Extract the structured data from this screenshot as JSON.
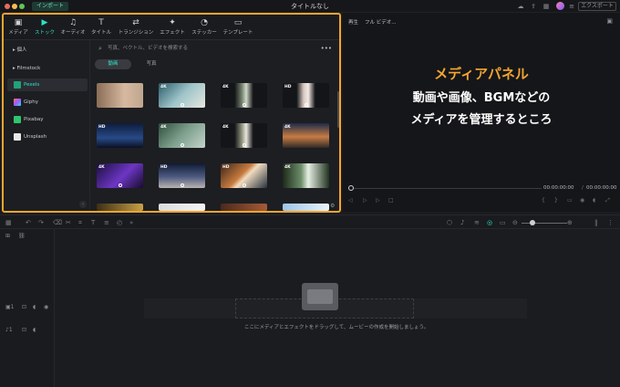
{
  "titlebar": {
    "import_label": "インポート",
    "window_title": "タイトルなし",
    "export_label": "エクスポート"
  },
  "media_panel": {
    "tabs": [
      {
        "label": "メディア",
        "icon": "folder-icon"
      },
      {
        "label": "ストック",
        "icon": "stock-icon",
        "active": true
      },
      {
        "label": "オーディオ",
        "icon": "music-icon"
      },
      {
        "label": "タイトル",
        "icon": "text-icon"
      },
      {
        "label": "トランジション",
        "icon": "transition-icon"
      },
      {
        "label": "エフェクト",
        "icon": "effects-icon"
      },
      {
        "label": "ステッカー",
        "icon": "sticker-icon"
      },
      {
        "label": "テンプレート",
        "icon": "template-icon"
      }
    ],
    "sidebar": {
      "personal": "個人",
      "filmstock": "Filmstock",
      "pexels": "Pexels",
      "giphy": "Giphy",
      "pixabay": "Pixabay",
      "unsplash": "Unsplash"
    },
    "search_placeholder": "写真、ベクトル、ビデオを検索する",
    "segments": {
      "video": "動画",
      "photo": "写真"
    },
    "thumbnails": [
      {
        "badge": ""
      },
      {
        "badge": "4K"
      },
      {
        "badge": "4K"
      },
      {
        "badge": "HD"
      },
      {
        "badge": "HD"
      },
      {
        "badge": "4K"
      },
      {
        "badge": "4K"
      },
      {
        "badge": "4K"
      },
      {
        "badge": "4K"
      },
      {
        "badge": "HD"
      },
      {
        "badge": "HD"
      },
      {
        "badge": "4K"
      },
      {
        "badge": ""
      },
      {
        "badge": ""
      },
      {
        "badge": ""
      },
      {
        "badge": ""
      }
    ]
  },
  "preview": {
    "label": "再生",
    "quality": "フル ビデオ...",
    "annotation_title": "メディアパネル",
    "annotation_line1": "動画や画像、BGMなどの",
    "annotation_line2": "メディアを管理するところ",
    "timecode_current": "00:00:00:00",
    "timecode_total": "00:00:00:00"
  },
  "timeline": {
    "drop_hint": "ここにメディアとエフェクトをドラッグして、ムービーの作成を開始しましょう。",
    "track_video": "1",
    "track_audio": "1"
  },
  "colors": {
    "accent": "#2ce0c7",
    "highlight": "#f4a531"
  }
}
